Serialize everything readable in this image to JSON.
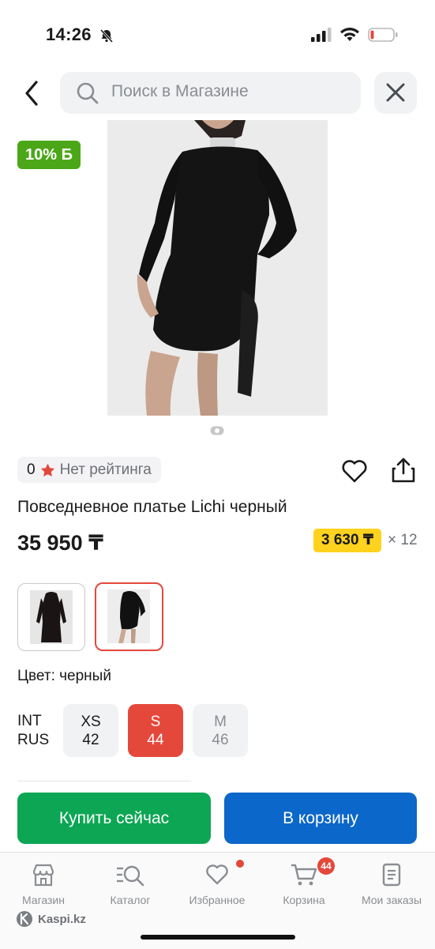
{
  "status_bar": {
    "time": "14:26"
  },
  "header": {
    "search_placeholder": "Поиск в Магазине"
  },
  "product": {
    "discount_badge": "10% Б",
    "rating_value": "0",
    "rating_text": "Нет рейтинга",
    "title": "Повседневное платье Lichi черный",
    "price": "35 950 ₸",
    "installment_price": "3 630 ₸",
    "installment_multiplier": "× 12",
    "color_label": "Цвет: черный",
    "size_systems": [
      "INT",
      "RUS"
    ],
    "sizes": [
      {
        "int": "XS",
        "rus": "42",
        "state": "available"
      },
      {
        "int": "S",
        "rus": "44",
        "state": "selected"
      },
      {
        "int": "M",
        "rus": "46",
        "state": "unavailable"
      }
    ],
    "selected_variant": 2,
    "image_count": 1
  },
  "actions": {
    "buy_now": "Купить сейчас",
    "add_to_cart": "В корзину"
  },
  "tab_bar": {
    "items": [
      {
        "label": "Магазин",
        "icon": "store-icon"
      },
      {
        "label": "Каталог",
        "icon": "catalog-search-icon"
      },
      {
        "label": "Избранное",
        "icon": "heart-icon",
        "dot": true
      },
      {
        "label": "Корзина",
        "icon": "cart-icon",
        "badge": "44"
      },
      {
        "label": "Мои заказы",
        "icon": "orders-icon"
      }
    ]
  },
  "footer": {
    "brand": "Kaspi.kz"
  },
  "colors": {
    "accent_red": "#e4483b",
    "buy_green": "#0da654",
    "cart_blue": "#0b67c9",
    "badge_green": "#4ba717",
    "installment_yellow": "#ffd21e"
  }
}
